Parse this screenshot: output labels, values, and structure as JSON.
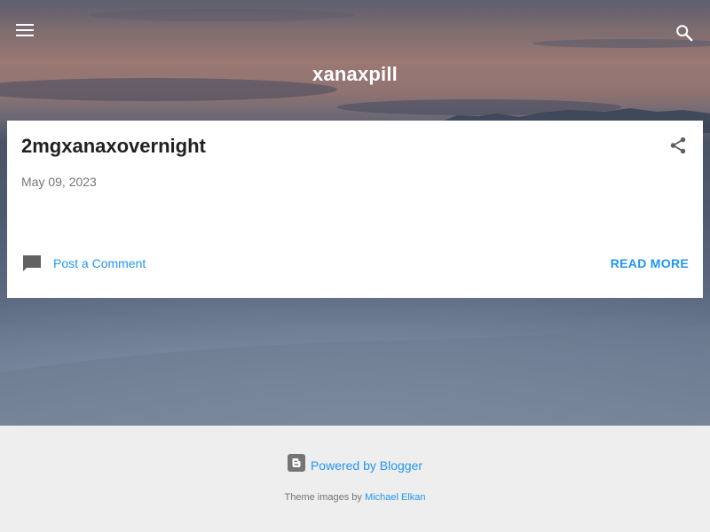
{
  "header": {
    "blog_title": "xanaxpill",
    "menu_icon": "hamburger-menu-icon",
    "search_icon": "search-icon"
  },
  "post": {
    "title": "2mgxanaxovernight",
    "date": "May 09, 2023",
    "share_icon": "share-icon",
    "comment_icon": "comment-icon",
    "comment_link": "Post a Comment",
    "read_more": "READ MORE"
  },
  "footer": {
    "powered_by": "Powered by Blogger",
    "blogger_icon": "blogger-logo-icon",
    "theme_prefix": "Theme images by",
    "theme_author": "Michael Elkan"
  },
  "colors": {
    "link": "#2196f3",
    "title_text": "#212121",
    "meta_text": "#757575",
    "footer_bg": "#eeeeee",
    "card_bg": "#ffffff"
  }
}
